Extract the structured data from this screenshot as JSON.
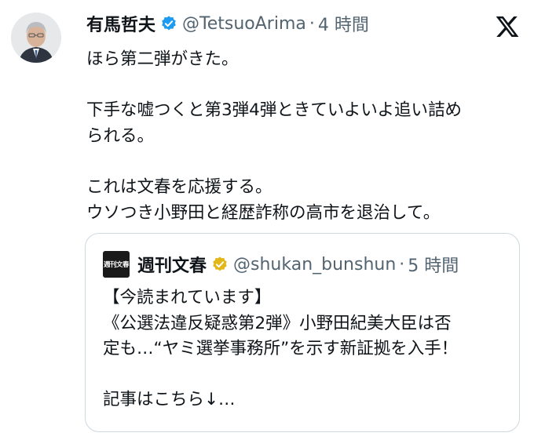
{
  "tweet": {
    "author_name": "有馬哲夫",
    "handle": "@TetsuoArima",
    "separator": "·",
    "time": "4 時間",
    "text": "ほら第二弾がきた。\n\n下手な嘘つくと第3弾4弾ときていよいよ追い詰め\nられる。\n\nこれは文春を応援する。\nウソつき小野田と経歴詐称の高市を退治して。",
    "verified_badge": "blue-verified-badge",
    "platform_logo": "x-logo"
  },
  "quote": {
    "account_logo_text": "週刊文春",
    "author_name": "週刊文春",
    "handle": "@shukan_bunshun",
    "separator": "·",
    "time": "5 時間",
    "verified_badge": "gold-verified-badge",
    "text": "【今読まれています】\n《公選法違反疑惑第2弾》小野田紀美大臣は否\n定も…“ヤミ選挙事務所”を示す新証拠を入手！\n\n記事はこちら↓…"
  },
  "colors": {
    "text": "#0f1419",
    "muted": "#536471",
    "blue_badge": "#1d9bf0",
    "gold_badge": "#e2b719",
    "border": "#cfd9de"
  }
}
